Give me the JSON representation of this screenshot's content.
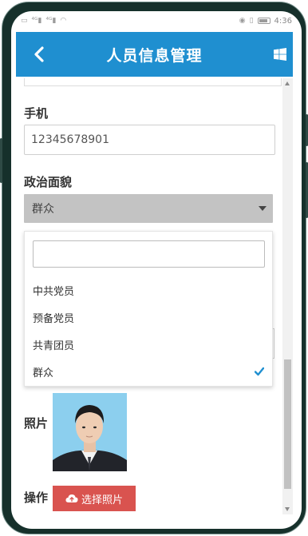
{
  "status_bar": {
    "time": "4:36",
    "left_icons": [
      "sim-icon",
      "signal-icon",
      "signal-icon",
      "wifi-icon"
    ],
    "right_icons": [
      "eye-icon",
      "vibrate-icon",
      "battery-icon"
    ]
  },
  "header": {
    "title": "人员信息管理",
    "back_icon": "chevron-left-icon",
    "right_icon": "windows-icon",
    "background": "#1f8fd0"
  },
  "form": {
    "phone_label": "手机",
    "phone_value": "12345678901",
    "political_label": "政治面貌",
    "political_selected": "群众",
    "photo_label": "照片",
    "action_label": "操作",
    "upload_button": "选择照片",
    "upload_icon": "cloud-upload-icon",
    "upload_color": "#d9534f"
  },
  "dropdown": {
    "search_value": "",
    "options": [
      "中共党员",
      "预备党员",
      "共青团员",
      "群众"
    ],
    "selected_index": 3,
    "check_color": "#1f8fd0"
  }
}
